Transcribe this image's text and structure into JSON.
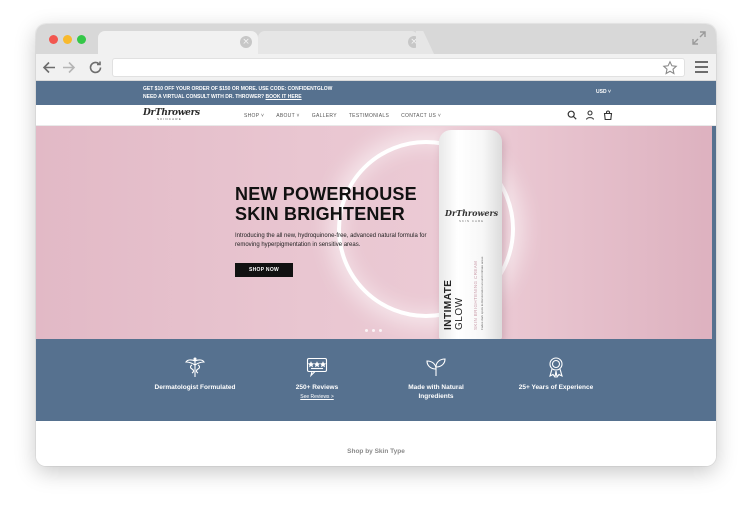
{
  "browser": {
    "tab_close_glyph": "×"
  },
  "announcement": {
    "line1": "GET $10 OFF YOUR ORDER OF $150 OR MORE. USE CODE: CONFIDENTGLOW",
    "line2": "NEED A VIRTUAL CONSULT WITH DR. THROWER?",
    "link": "BOOK IT HERE",
    "currency": "USD ˅"
  },
  "site_nav": {
    "logo_main": "DrThrowers",
    "logo_sub": "SKINCARE",
    "menu": [
      "SHOP ˅",
      "ABOUT ˅",
      "GALLERY",
      "TESTIMONIALS",
      "CONTACT US ˅"
    ]
  },
  "hero": {
    "title_line1": "NEW POWERHOUSE",
    "title_line2": "SKIN BRIGHTENER",
    "description": "Introducing the all new, hydroquinone-free, advanced natural formula for removing hyperpigmentation in sensitive areas.",
    "button_label": "SHOP NOW",
    "product": {
      "brand": "DrThrowers",
      "brand_sub": "SKIN CARE",
      "name_line1": "INTIMATE",
      "name_line2": "GLOW",
      "subtitle": "SKIN BRIGHTENING CREAM",
      "fine_print": "Fades dark spots & discoloration around intimate areas"
    }
  },
  "features": [
    {
      "label": "Dermatologist Formulated",
      "icon": "caduceus-icon"
    },
    {
      "label": "250+ Reviews",
      "icon": "review-stars-icon",
      "link": "See Reviews >"
    },
    {
      "label_line1": "Made with Natural",
      "label_line2": "Ingredients",
      "icon": "leaf-icon"
    },
    {
      "label": "25+ Years of Experience",
      "icon": "award-ribbon-icon"
    }
  ],
  "shop_section": {
    "title": "Shop by Skin Type"
  },
  "colors": {
    "brand_blue": "#56718f",
    "hero_pink": "#e9c6d1",
    "button_black": "#111111"
  }
}
